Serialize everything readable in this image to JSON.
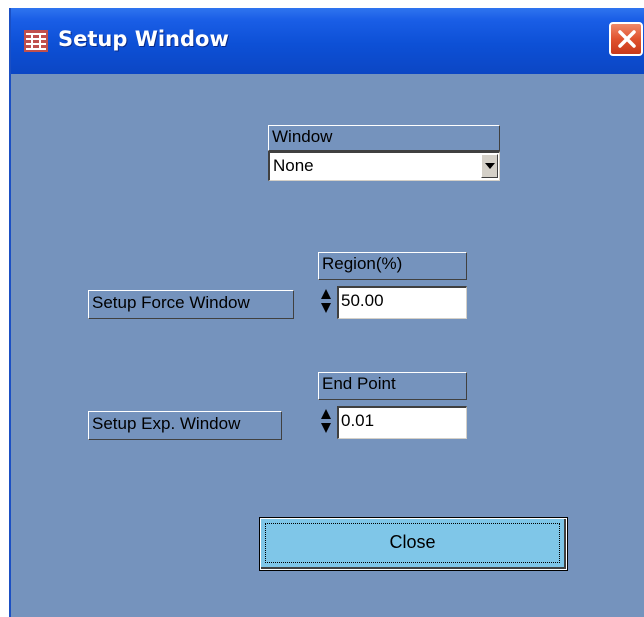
{
  "window": {
    "title": "Setup Window",
    "icon": "grid-app-icon",
    "close_icon": "close-icon",
    "accent": "#0b46c4",
    "background": "#7593bd"
  },
  "window_select": {
    "label": "Window",
    "value": "None",
    "dropdown_icon": "chevron-down-icon"
  },
  "force_window": {
    "button_label": "Setup Force Window",
    "field_label": "Region(%)",
    "value": "50.00"
  },
  "exp_window": {
    "button_label": "Setup Exp. Window",
    "field_label": "End Point",
    "value": "0.01"
  },
  "close_button": {
    "label": "Close",
    "color": "#7fc6e8"
  }
}
